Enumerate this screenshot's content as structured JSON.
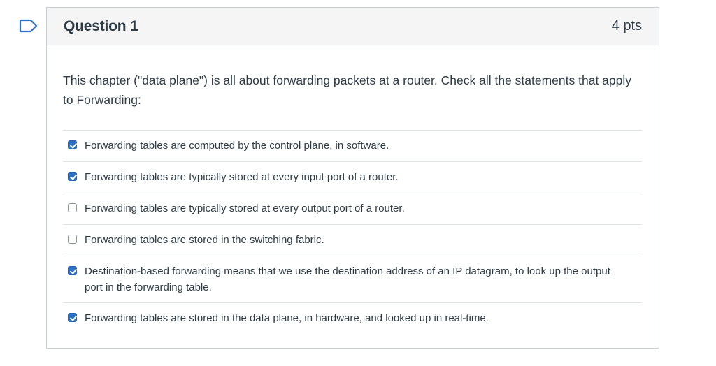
{
  "flag": {
    "icon": "flag-outline-icon",
    "color": "#2c72c7"
  },
  "question": {
    "title": "Question 1",
    "points": "4 pts",
    "text": "This chapter (\"data plane\") is all about forwarding packets at a router. Check all the statements that apply to Forwarding:",
    "answers": [
      {
        "label": "Forwarding tables are computed by the control plane, in software.",
        "checked": true
      },
      {
        "label": "Forwarding tables are typically stored at every input port of a router.",
        "checked": true
      },
      {
        "label": "Forwarding tables are typically stored at every output port of a router.",
        "checked": false
      },
      {
        "label": "Forwarding tables are stored in the switching fabric.",
        "checked": false
      },
      {
        "label": "Destination-based forwarding means that we use the destination address of an IP datagram, to look up the output port in the forwarding table.",
        "checked": true
      },
      {
        "label": "Forwarding tables are stored in the data plane, in hardware, and looked up in real-time.",
        "checked": true
      }
    ]
  },
  "colors": {
    "accent": "#2c72c7",
    "text": "#2d3b45",
    "border": "#c7cdd1",
    "header_bg": "#f5f5f5"
  }
}
